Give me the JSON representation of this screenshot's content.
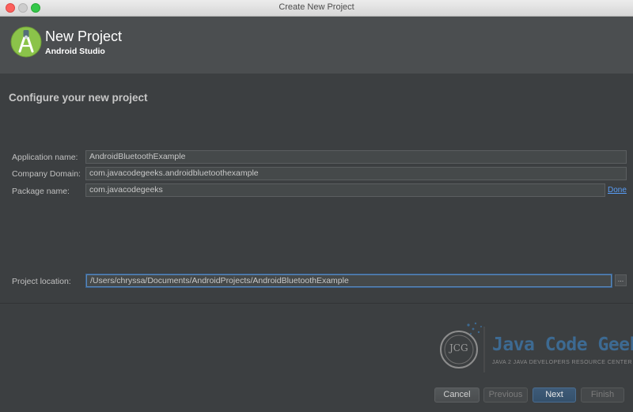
{
  "window": {
    "title": "Create New Project"
  },
  "header": {
    "title": "New Project",
    "subtitle": "Android Studio"
  },
  "form": {
    "section_title": "Configure your new project",
    "application_name": {
      "label": "Application name:",
      "value": "AndroidBluetoothExample"
    },
    "company_domain": {
      "label": "Company Domain:",
      "value": "com.javacodegeeks.androidbluetoothexample"
    },
    "package_name": {
      "label": "Package name:",
      "value": "com.javacodegeeks",
      "action": "Done"
    },
    "project_location": {
      "label": "Project location:",
      "value": "/Users/chryssa/Documents/AndroidProjects/AndroidBluetoothExample",
      "browse": "..."
    }
  },
  "watermark": {
    "initials": "JCG",
    "name": "Java Code Geeks",
    "tagline": "JAVA 2 JAVA DEVELOPERS RESOURCE CENTER"
  },
  "buttons": {
    "cancel": "Cancel",
    "previous": "Previous",
    "next": "Next",
    "finish": "Finish"
  },
  "colors": {
    "background": "#3c3f41",
    "header": "#4b4e50",
    "accent": "#589df6",
    "android_green": "#8bc34a"
  }
}
